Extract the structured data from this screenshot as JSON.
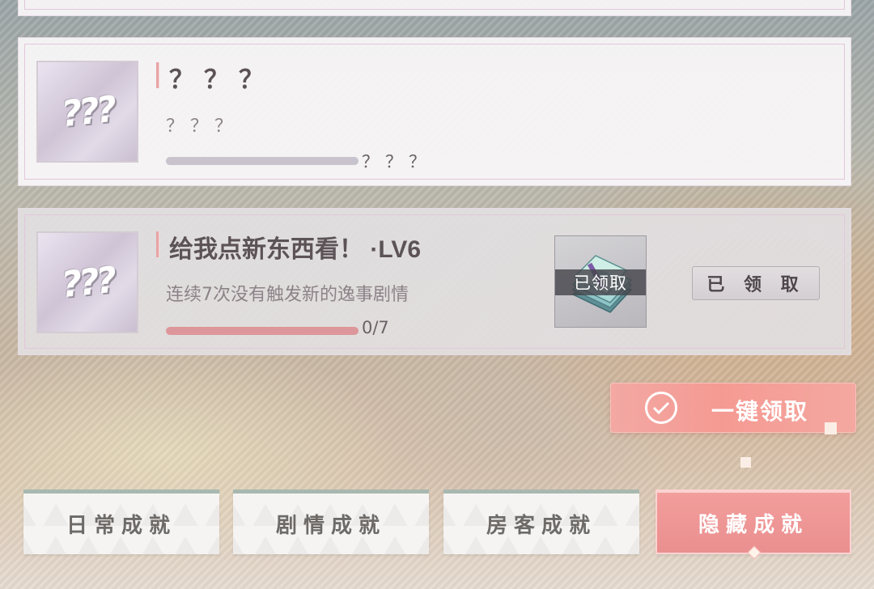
{
  "achievements": [
    {
      "title": "？？？",
      "description": "？？？",
      "progress_text": "？？？",
      "progress": 0,
      "thumb_text": "???",
      "state": "hidden"
    },
    {
      "title": "给我点新东西看！ ·LV6",
      "description": "连续7次没有触发新的逸事剧情",
      "progress_text": "0/7",
      "progress": 1.0,
      "thumb_text": "???",
      "reward_label": "已领取",
      "reward_icon": "cash-stack-icon",
      "button_label": "已 领 取",
      "state": "claimed"
    }
  ],
  "claim_all_label": "一键领取",
  "tabs": [
    {
      "label": "日常成就",
      "active": false
    },
    {
      "label": "剧情成就",
      "active": false
    },
    {
      "label": "房客成就",
      "active": false
    },
    {
      "label": "隐藏成就",
      "active": true
    }
  ],
  "colors": {
    "accent": "#f59a93",
    "tab_border": "#a8b8b0",
    "progress_claimed": "#dd9699"
  }
}
